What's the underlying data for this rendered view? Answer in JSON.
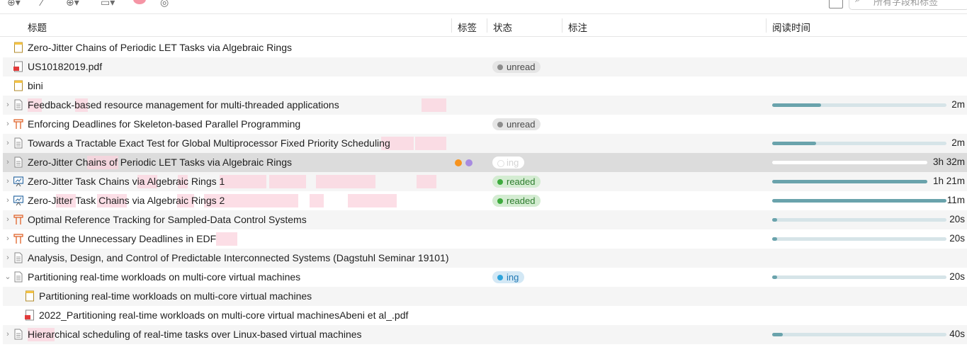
{
  "toolbar": {
    "icons": [
      "new-item-icon",
      "wand-icon",
      "new-note-icon",
      "note-menu-icon",
      "color-dot-icon",
      "sync-icon"
    ],
    "search_placeholder": "所有字段和标签"
  },
  "columns": {
    "title": "标题",
    "tags": "标签",
    "status": "状态",
    "annotation": "标注",
    "reading_time": "阅读时间"
  },
  "colors": {
    "progress_fill": "#6aa3ac",
    "progress_track": "#d6e4e8",
    "tag_orange": "#f7931e",
    "tag_purple": "#a78be0",
    "highlight_pink": "#fbd3de"
  },
  "rows": [
    {
      "title": "Zero-Jitter Chains of Periodic LET Tasks via Algebraic Rings",
      "icon": "note-icon",
      "expander": "none",
      "status": "",
      "progress": null,
      "time": ""
    },
    {
      "title": "US10182019.pdf",
      "icon": "pdf-icon",
      "expander": "none",
      "status": "unread",
      "progress": null,
      "time": ""
    },
    {
      "title": "bini",
      "icon": "note-icon",
      "expander": "none",
      "status": "",
      "progress": null,
      "time": ""
    },
    {
      "title": "Feedback-based resource management for multi-threaded applications",
      "icon": "document-icon",
      "expander": "collapsed",
      "status": "",
      "progress": 0.28,
      "time": "2m"
    },
    {
      "title": "Enforcing Deadlines for Skeleton-based Parallel Programming",
      "icon": "conference-paper-icon",
      "expander": "collapsed",
      "status": "unread",
      "progress": null,
      "time": ""
    },
    {
      "title": "Towards a Tractable Exact Test for Global Multiprocessor Fixed Priority Scheduling",
      "icon": "document-icon",
      "expander": "collapsed",
      "status": "",
      "progress": 0.25,
      "time": "2m"
    },
    {
      "title": "Zero-Jitter Chains of Periodic LET Tasks via Algebraic Rings",
      "icon": "document-icon",
      "expander": "collapsed",
      "status": "ing",
      "tags": [
        "orange",
        "purple"
      ],
      "progress": 0.0,
      "time": "3h 32m",
      "selected": true
    },
    {
      "title": "Zero-Jitter Task Chains via Algebraic Rings 1",
      "icon": "presentation-icon",
      "expander": "collapsed",
      "status": "readed",
      "progress": 1.0,
      "time": "1h 21m"
    },
    {
      "title": "Zero-Jitter Task Chains via Algebraic Rings 2",
      "icon": "presentation-icon",
      "expander": "collapsed",
      "status": "readed",
      "progress": 1.0,
      "time": "11m"
    },
    {
      "title": "Optimal Reference Tracking for Sampled-Data Control Systems",
      "icon": "conference-paper-icon",
      "expander": "collapsed",
      "status": "",
      "progress": 0.03,
      "time": "20s"
    },
    {
      "title": "Cutting the Unnecessary Deadlines in EDF",
      "icon": "conference-paper-icon",
      "expander": "collapsed",
      "status": "",
      "progress": 0.03,
      "time": "20s"
    },
    {
      "title": "Analysis, Design, and Control of Predictable Interconnected Systems (Dagstuhl Seminar 19101)",
      "icon": "document-icon",
      "expander": "collapsed",
      "status": "",
      "progress": null,
      "time": ""
    },
    {
      "title": "Partitioning real-time workloads on multi-core virtual machines",
      "icon": "document-icon",
      "expander": "expanded",
      "status": "ing",
      "progress": 0.03,
      "time": "20s"
    },
    {
      "title": "Partitioning real-time workloads on multi-core virtual machines",
      "icon": "note-icon",
      "expander": "child",
      "status": "",
      "progress": null,
      "time": ""
    },
    {
      "title": "2022_Partitioning real-time workloads on multi-core virtual machinesAbeni et al_.pdf",
      "icon": "pdf-icon",
      "expander": "child",
      "status": "",
      "progress": null,
      "time": ""
    },
    {
      "title": "Hierarchical scheduling of real-time tasks over Linux-based virtual machines",
      "icon": "document-icon",
      "expander": "collapsed",
      "status": "",
      "progress": 0.06,
      "time": "40s"
    }
  ]
}
